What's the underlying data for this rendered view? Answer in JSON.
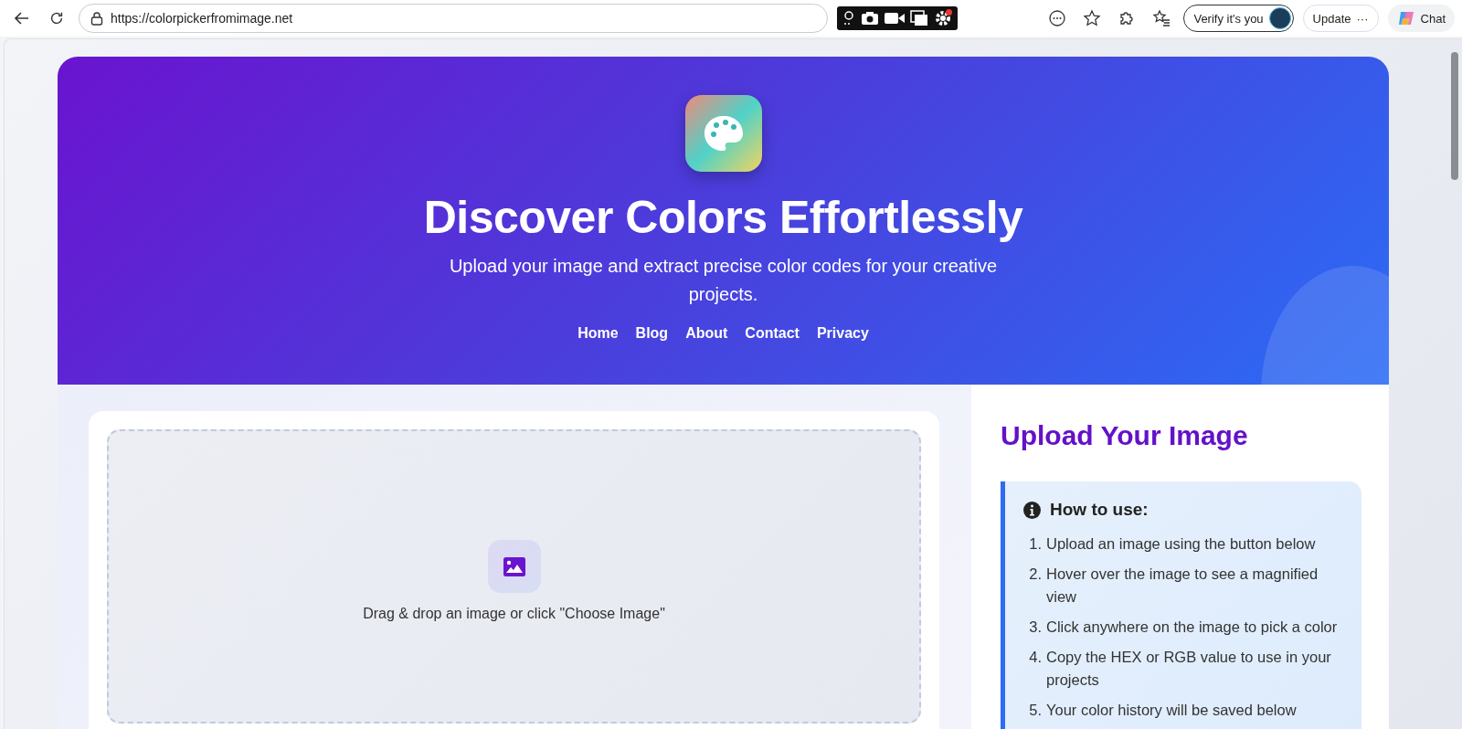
{
  "browser": {
    "url": "https://colorpickerfromimage.net",
    "verify_label": "Verify it's you",
    "update_label": "Update",
    "update_more": "···",
    "chat_label": "Chat"
  },
  "header": {
    "title": "Discover Colors Effortlessly",
    "subtitle": "Upload your image and extract precise color codes for your creative projects.",
    "nav": [
      {
        "label": "Home"
      },
      {
        "label": "Blog"
      },
      {
        "label": "About"
      },
      {
        "label": "Contact"
      },
      {
        "label": "Privacy"
      }
    ]
  },
  "dropzone": {
    "hint": "Drag & drop an image or click \"Choose Image\""
  },
  "sidebar": {
    "heading": "Upload Your Image",
    "howto": {
      "title": "How to use:",
      "steps": [
        {
          "number": "1.",
          "text": "Upload an image using the button below"
        },
        {
          "number": "2.",
          "text": "Hover over the image to see a magnified view"
        },
        {
          "number": "3.",
          "text": "Click anywhere on the image to pick a color"
        },
        {
          "number": "4.",
          "text": "Copy the HEX or RGB value to use in your projects"
        },
        {
          "number": "5.",
          "text": "Your color history will be saved below"
        }
      ]
    }
  }
}
